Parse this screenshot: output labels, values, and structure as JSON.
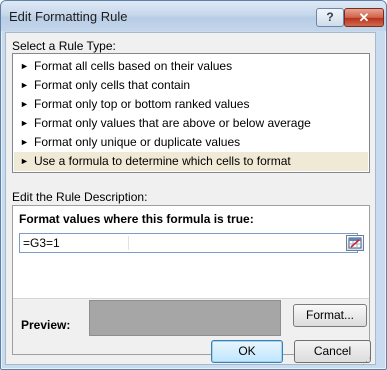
{
  "window": {
    "title": "Edit Formatting Rule"
  },
  "titlebar": {
    "help_label": "?",
    "close_label": "✕"
  },
  "rule_type": {
    "label": "Select a Rule Type:",
    "items": [
      {
        "label": "Format all cells based on their values"
      },
      {
        "label": "Format only cells that contain"
      },
      {
        "label": "Format only top or bottom ranked values"
      },
      {
        "label": "Format only values that are above or below average"
      },
      {
        "label": "Format only unique or duplicate values"
      },
      {
        "label": "Use a formula to determine which cells to format",
        "selected": true
      }
    ],
    "arrow_glyph": "►"
  },
  "description": {
    "label": "Edit the Rule Description:",
    "heading": "Format values where this formula is true:",
    "formula_value": "=G3=1",
    "preview_label": "Preview:",
    "preview_color": "#a6a6a6",
    "format_button": "Format..."
  },
  "footer": {
    "ok_label": "OK",
    "cancel_label": "Cancel"
  }
}
